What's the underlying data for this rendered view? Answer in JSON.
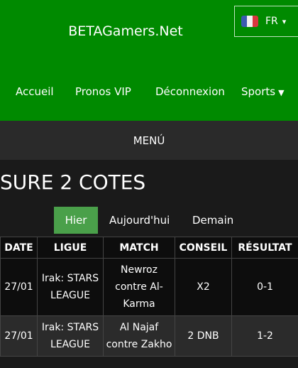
{
  "header": {
    "title": "BETAGamers.Net",
    "lang": {
      "code": "FR",
      "flag": "fr-flag-icon"
    },
    "nav": [
      "Accueil",
      "Pronos VIP",
      "Déconnexion",
      "Sports"
    ]
  },
  "menu": {
    "label": "MENÚ"
  },
  "page": {
    "title": "SURE 2 COTES"
  },
  "tabs": [
    "Hier",
    "Aujourd'hui",
    "Demain"
  ],
  "table": {
    "headers": [
      "DATE",
      "LIGUE",
      "MATCH",
      "CONSEIL",
      "RÉSULTAT"
    ],
    "rows": [
      [
        "27/01",
        "Irak: STARS LEAGUE",
        "Newroz contre Al-Karma",
        "X2",
        "0-1"
      ],
      [
        "27/01",
        "Irak: STARS LEAGUE",
        "Al Najaf contre Zakho",
        "2 DNB",
        "1-2"
      ]
    ]
  },
  "colors": {
    "header_bg": "#008a00",
    "active_tab": "#4aa04a",
    "page_bg": "#1a1a1a"
  }
}
